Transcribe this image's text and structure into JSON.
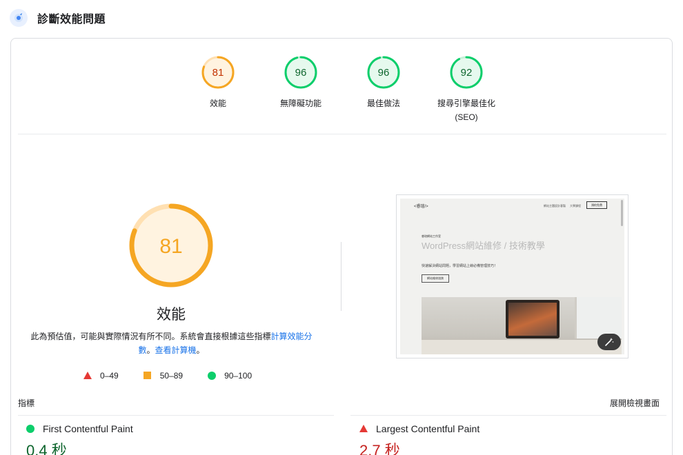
{
  "header": {
    "title": "診斷效能問題",
    "icon": "lighthouse-icon"
  },
  "colors": {
    "green": "#0cce6b",
    "orange": "#ffa400",
    "red": "#ff4e42",
    "link": "#1a73e8"
  },
  "categories": [
    {
      "score": "81",
      "value": 81,
      "label": "效能",
      "label2": "",
      "status": "orange"
    },
    {
      "score": "96",
      "value": 96,
      "label": "無障礙功能",
      "label2": "",
      "status": "green"
    },
    {
      "score": "96",
      "value": 96,
      "label": "最佳做法",
      "label2": "",
      "status": "green"
    },
    {
      "score": "92",
      "value": 92,
      "label": "搜尋引擎最佳化",
      "label2": "(SEO)",
      "status": "green"
    }
  ],
  "performance": {
    "score": "81",
    "value": 81,
    "title": "效能",
    "desc_prefix": "此為預估值，可能與實際情況有所不同。系統會直接根據這些指標",
    "desc_link1": "計算效能分數",
    "desc_sep": "。",
    "desc_link2": "查看計算機",
    "desc_suffix": "。"
  },
  "legend": [
    {
      "range": "0–49",
      "shape": "triangle",
      "color": "#e53935"
    },
    {
      "range": "50–89",
      "shape": "square",
      "color": "#f5a623"
    },
    {
      "range": "90–100",
      "shape": "circle",
      "color": "#0cce6b"
    }
  ],
  "screenshot": {
    "logo": "<睿瑄/>",
    "nav1": "網站主題設計客製",
    "nav2": "大學課程",
    "button": "預約免費",
    "kicker": "睿瑄網站工作室",
    "headline": "WordPress網站維修 / 技術教學",
    "subline": "快速解決網站問題，學習網站上線必備管理技巧！",
    "cta": "網站維修諮詢"
  },
  "metrics_header": {
    "label": "指標",
    "expand": "展開檢視畫面"
  },
  "metrics": [
    {
      "name": "First Contentful Paint",
      "value": "0.4 秒",
      "status": "green"
    },
    {
      "name": "Largest Contentful Paint",
      "value": "2.7 秒",
      "status": "red"
    }
  ]
}
